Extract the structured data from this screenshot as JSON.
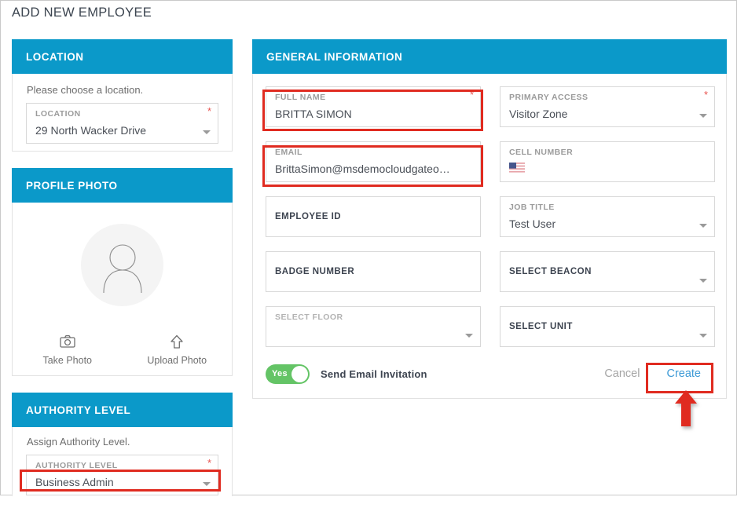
{
  "page": {
    "title": "ADD NEW EMPLOYEE"
  },
  "location_panel": {
    "header": "LOCATION",
    "helper": "Please choose a location.",
    "field": {
      "label": "LOCATION",
      "value": "29 North Wacker Drive",
      "required_mark": "*"
    }
  },
  "profile_panel": {
    "header": "PROFILE PHOTO",
    "avatar_icon": "user-avatar-icon",
    "take_photo": {
      "label": "Take Photo",
      "icon": "camera-icon"
    },
    "upload_photo": {
      "label": "Upload Photo",
      "icon": "upload-arrow-icon"
    }
  },
  "authority_panel": {
    "header": "AUTHORITY LEVEL",
    "helper": "Assign Authority Level.",
    "field": {
      "label": "AUTHORITY LEVEL",
      "value": "Business Admin",
      "required_mark": "*"
    }
  },
  "general_panel": {
    "header": "GENERAL INFORMATION",
    "fields": [
      {
        "label": "FULL NAME",
        "value": "BRITTA SIMON",
        "required_mark": "*",
        "type": "text",
        "highlighted": true
      },
      {
        "label": "PRIMARY ACCESS",
        "value": "Visitor Zone",
        "required_mark": "*",
        "type": "select"
      },
      {
        "label": "EMAIL",
        "value": "BrittaSimon@msdemocloudgateo…",
        "type": "text",
        "highlighted": true
      },
      {
        "label": "CELL NUMBER",
        "value": "",
        "type": "phone",
        "flag_icon": "us-flag-icon"
      },
      {
        "label": "EMPLOYEE ID",
        "value": "",
        "type": "text"
      },
      {
        "label": "JOB TITLE",
        "value": "Test User",
        "type": "select"
      },
      {
        "label": "BADGE NUMBER",
        "value": "",
        "type": "text"
      },
      {
        "label": "SELECT BEACON",
        "value": "",
        "type": "select"
      },
      {
        "label": "SELECT FLOOR",
        "value": "",
        "type": "select",
        "muted_label": true
      },
      {
        "label": "SELECT UNIT",
        "value": "",
        "type": "select"
      }
    ],
    "email_toggle": {
      "state_text": "Yes",
      "label": "Send Email Invitation"
    },
    "cancel_label": "Cancel",
    "create_label": "Create"
  },
  "annotations": {
    "highlight_color": "#e02b20",
    "arrow_icon": "up-arrow-annotation"
  },
  "colors": {
    "header_blue": "#0b99c9",
    "toggle_green": "#64c466",
    "create_blue": "#3d9ad6"
  }
}
